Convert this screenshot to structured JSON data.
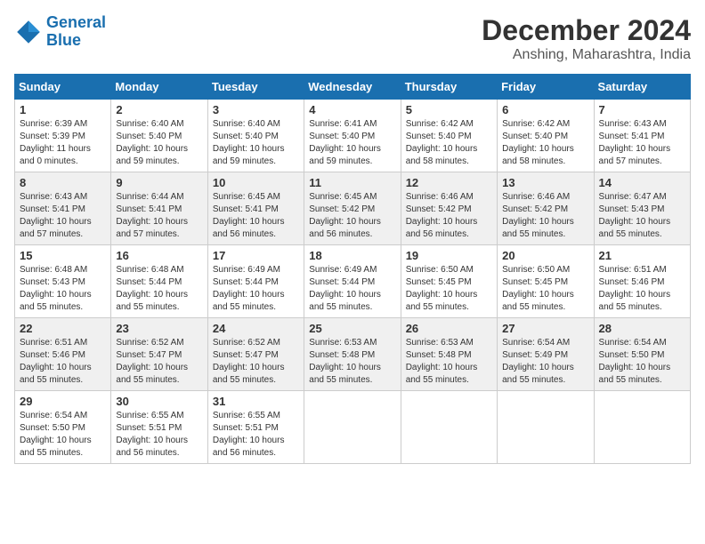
{
  "logo": {
    "line1": "General",
    "line2": "Blue"
  },
  "title": "December 2024",
  "subtitle": "Anshing, Maharashtra, India",
  "days_of_week": [
    "Sunday",
    "Monday",
    "Tuesday",
    "Wednesday",
    "Thursday",
    "Friday",
    "Saturday"
  ],
  "weeks": [
    [
      {
        "day": "1",
        "sunrise": "6:39 AM",
        "sunset": "5:39 PM",
        "daylight": "11 hours and 0 minutes."
      },
      {
        "day": "2",
        "sunrise": "6:40 AM",
        "sunset": "5:40 PM",
        "daylight": "10 hours and 59 minutes."
      },
      {
        "day": "3",
        "sunrise": "6:40 AM",
        "sunset": "5:40 PM",
        "daylight": "10 hours and 59 minutes."
      },
      {
        "day": "4",
        "sunrise": "6:41 AM",
        "sunset": "5:40 PM",
        "daylight": "10 hours and 59 minutes."
      },
      {
        "day": "5",
        "sunrise": "6:42 AM",
        "sunset": "5:40 PM",
        "daylight": "10 hours and 58 minutes."
      },
      {
        "day": "6",
        "sunrise": "6:42 AM",
        "sunset": "5:40 PM",
        "daylight": "10 hours and 58 minutes."
      },
      {
        "day": "7",
        "sunrise": "6:43 AM",
        "sunset": "5:41 PM",
        "daylight": "10 hours and 57 minutes."
      }
    ],
    [
      {
        "day": "8",
        "sunrise": "6:43 AM",
        "sunset": "5:41 PM",
        "daylight": "10 hours and 57 minutes."
      },
      {
        "day": "9",
        "sunrise": "6:44 AM",
        "sunset": "5:41 PM",
        "daylight": "10 hours and 57 minutes."
      },
      {
        "day": "10",
        "sunrise": "6:45 AM",
        "sunset": "5:41 PM",
        "daylight": "10 hours and 56 minutes."
      },
      {
        "day": "11",
        "sunrise": "6:45 AM",
        "sunset": "5:42 PM",
        "daylight": "10 hours and 56 minutes."
      },
      {
        "day": "12",
        "sunrise": "6:46 AM",
        "sunset": "5:42 PM",
        "daylight": "10 hours and 56 minutes."
      },
      {
        "day": "13",
        "sunrise": "6:46 AM",
        "sunset": "5:42 PM",
        "daylight": "10 hours and 55 minutes."
      },
      {
        "day": "14",
        "sunrise": "6:47 AM",
        "sunset": "5:43 PM",
        "daylight": "10 hours and 55 minutes."
      }
    ],
    [
      {
        "day": "15",
        "sunrise": "6:48 AM",
        "sunset": "5:43 PM",
        "daylight": "10 hours and 55 minutes."
      },
      {
        "day": "16",
        "sunrise": "6:48 AM",
        "sunset": "5:44 PM",
        "daylight": "10 hours and 55 minutes."
      },
      {
        "day": "17",
        "sunrise": "6:49 AM",
        "sunset": "5:44 PM",
        "daylight": "10 hours and 55 minutes."
      },
      {
        "day": "18",
        "sunrise": "6:49 AM",
        "sunset": "5:44 PM",
        "daylight": "10 hours and 55 minutes."
      },
      {
        "day": "19",
        "sunrise": "6:50 AM",
        "sunset": "5:45 PM",
        "daylight": "10 hours and 55 minutes."
      },
      {
        "day": "20",
        "sunrise": "6:50 AM",
        "sunset": "5:45 PM",
        "daylight": "10 hours and 55 minutes."
      },
      {
        "day": "21",
        "sunrise": "6:51 AM",
        "sunset": "5:46 PM",
        "daylight": "10 hours and 55 minutes."
      }
    ],
    [
      {
        "day": "22",
        "sunrise": "6:51 AM",
        "sunset": "5:46 PM",
        "daylight": "10 hours and 55 minutes."
      },
      {
        "day": "23",
        "sunrise": "6:52 AM",
        "sunset": "5:47 PM",
        "daylight": "10 hours and 55 minutes."
      },
      {
        "day": "24",
        "sunrise": "6:52 AM",
        "sunset": "5:47 PM",
        "daylight": "10 hours and 55 minutes."
      },
      {
        "day": "25",
        "sunrise": "6:53 AM",
        "sunset": "5:48 PM",
        "daylight": "10 hours and 55 minutes."
      },
      {
        "day": "26",
        "sunrise": "6:53 AM",
        "sunset": "5:48 PM",
        "daylight": "10 hours and 55 minutes."
      },
      {
        "day": "27",
        "sunrise": "6:54 AM",
        "sunset": "5:49 PM",
        "daylight": "10 hours and 55 minutes."
      },
      {
        "day": "28",
        "sunrise": "6:54 AM",
        "sunset": "5:50 PM",
        "daylight": "10 hours and 55 minutes."
      }
    ],
    [
      {
        "day": "29",
        "sunrise": "6:54 AM",
        "sunset": "5:50 PM",
        "daylight": "10 hours and 55 minutes."
      },
      {
        "day": "30",
        "sunrise": "6:55 AM",
        "sunset": "5:51 PM",
        "daylight": "10 hours and 56 minutes."
      },
      {
        "day": "31",
        "sunrise": "6:55 AM",
        "sunset": "5:51 PM",
        "daylight": "10 hours and 56 minutes."
      },
      null,
      null,
      null,
      null
    ]
  ]
}
